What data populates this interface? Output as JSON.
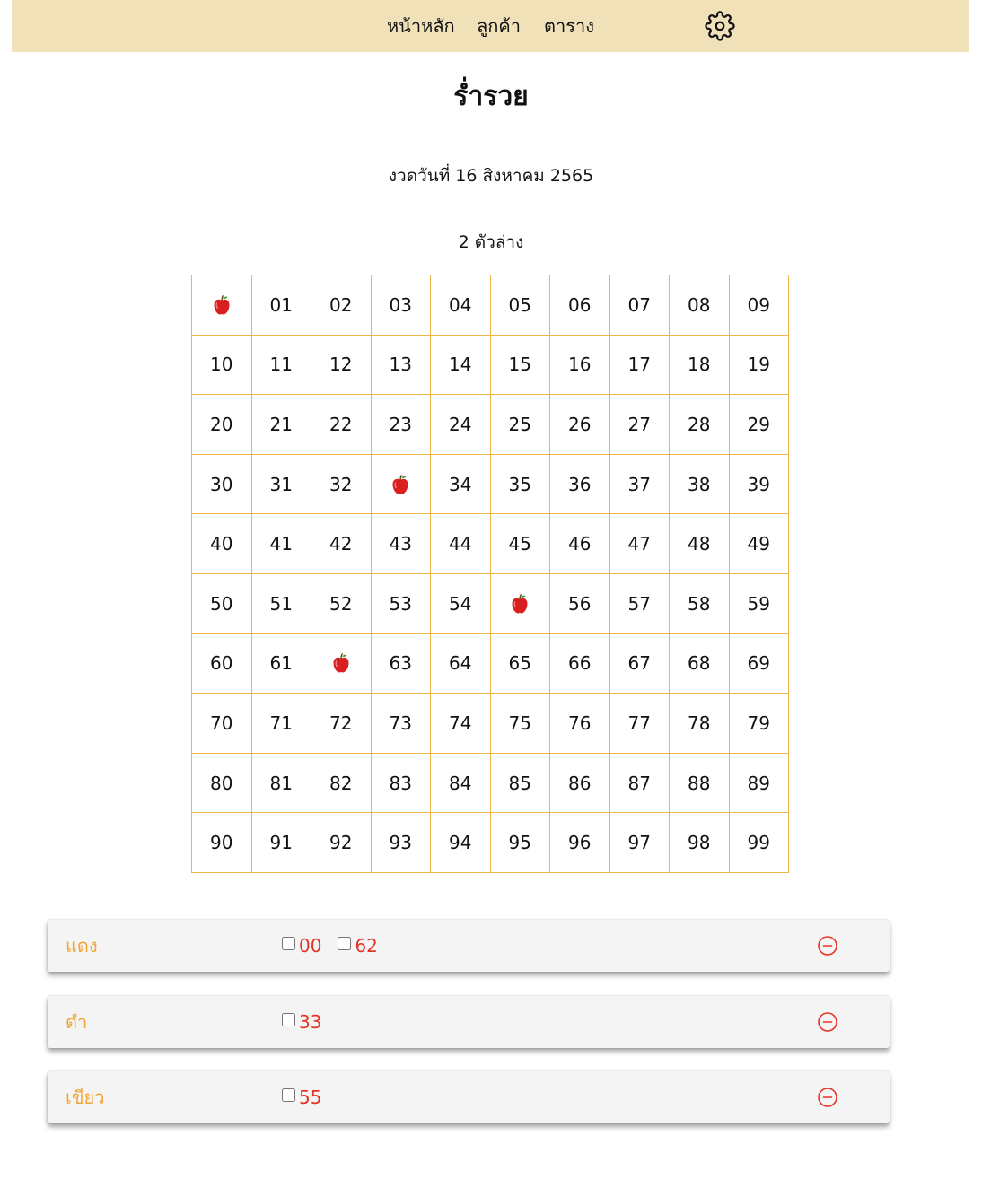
{
  "nav": {
    "home": "หน้าหลัก",
    "customers": "ลูกค้า",
    "table": "ตาราง",
    "settings_icon": "gear-icon"
  },
  "title": "ร่ำรวย",
  "draw_date": "งวดวันที่ 16 สิงหาคม 2565",
  "grid_label": "2 ตัวล่าง",
  "grid": {
    "numbers": [
      "00",
      "01",
      "02",
      "03",
      "04",
      "05",
      "06",
      "07",
      "08",
      "09",
      "10",
      "11",
      "12",
      "13",
      "14",
      "15",
      "16",
      "17",
      "18",
      "19",
      "20",
      "21",
      "22",
      "23",
      "24",
      "25",
      "26",
      "27",
      "28",
      "29",
      "30",
      "31",
      "32",
      "33",
      "34",
      "35",
      "36",
      "37",
      "38",
      "39",
      "40",
      "41",
      "42",
      "43",
      "44",
      "45",
      "46",
      "47",
      "48",
      "49",
      "50",
      "51",
      "52",
      "53",
      "54",
      "55",
      "56",
      "57",
      "58",
      "59",
      "60",
      "61",
      "62",
      "63",
      "64",
      "65",
      "66",
      "67",
      "68",
      "69",
      "70",
      "71",
      "72",
      "73",
      "74",
      "75",
      "76",
      "77",
      "78",
      "79",
      "80",
      "81",
      "82",
      "83",
      "84",
      "85",
      "86",
      "87",
      "88",
      "89",
      "90",
      "91",
      "92",
      "93",
      "94",
      "95",
      "96",
      "97",
      "98",
      "99"
    ],
    "marked": [
      "00",
      "33",
      "55",
      "62"
    ],
    "marker_icon": "apple-icon"
  },
  "groups": [
    {
      "name": "แดง",
      "numbers": [
        "00",
        "62"
      ]
    },
    {
      "name": "ดำ",
      "numbers": [
        "33"
      ]
    },
    {
      "name": "เขียว",
      "numbers": [
        "55"
      ]
    }
  ],
  "colors": {
    "nav_bg": "#f1e1b9",
    "grid_border": "#f0b54a",
    "group_name": "#f0a535",
    "number_red": "#e53325"
  }
}
